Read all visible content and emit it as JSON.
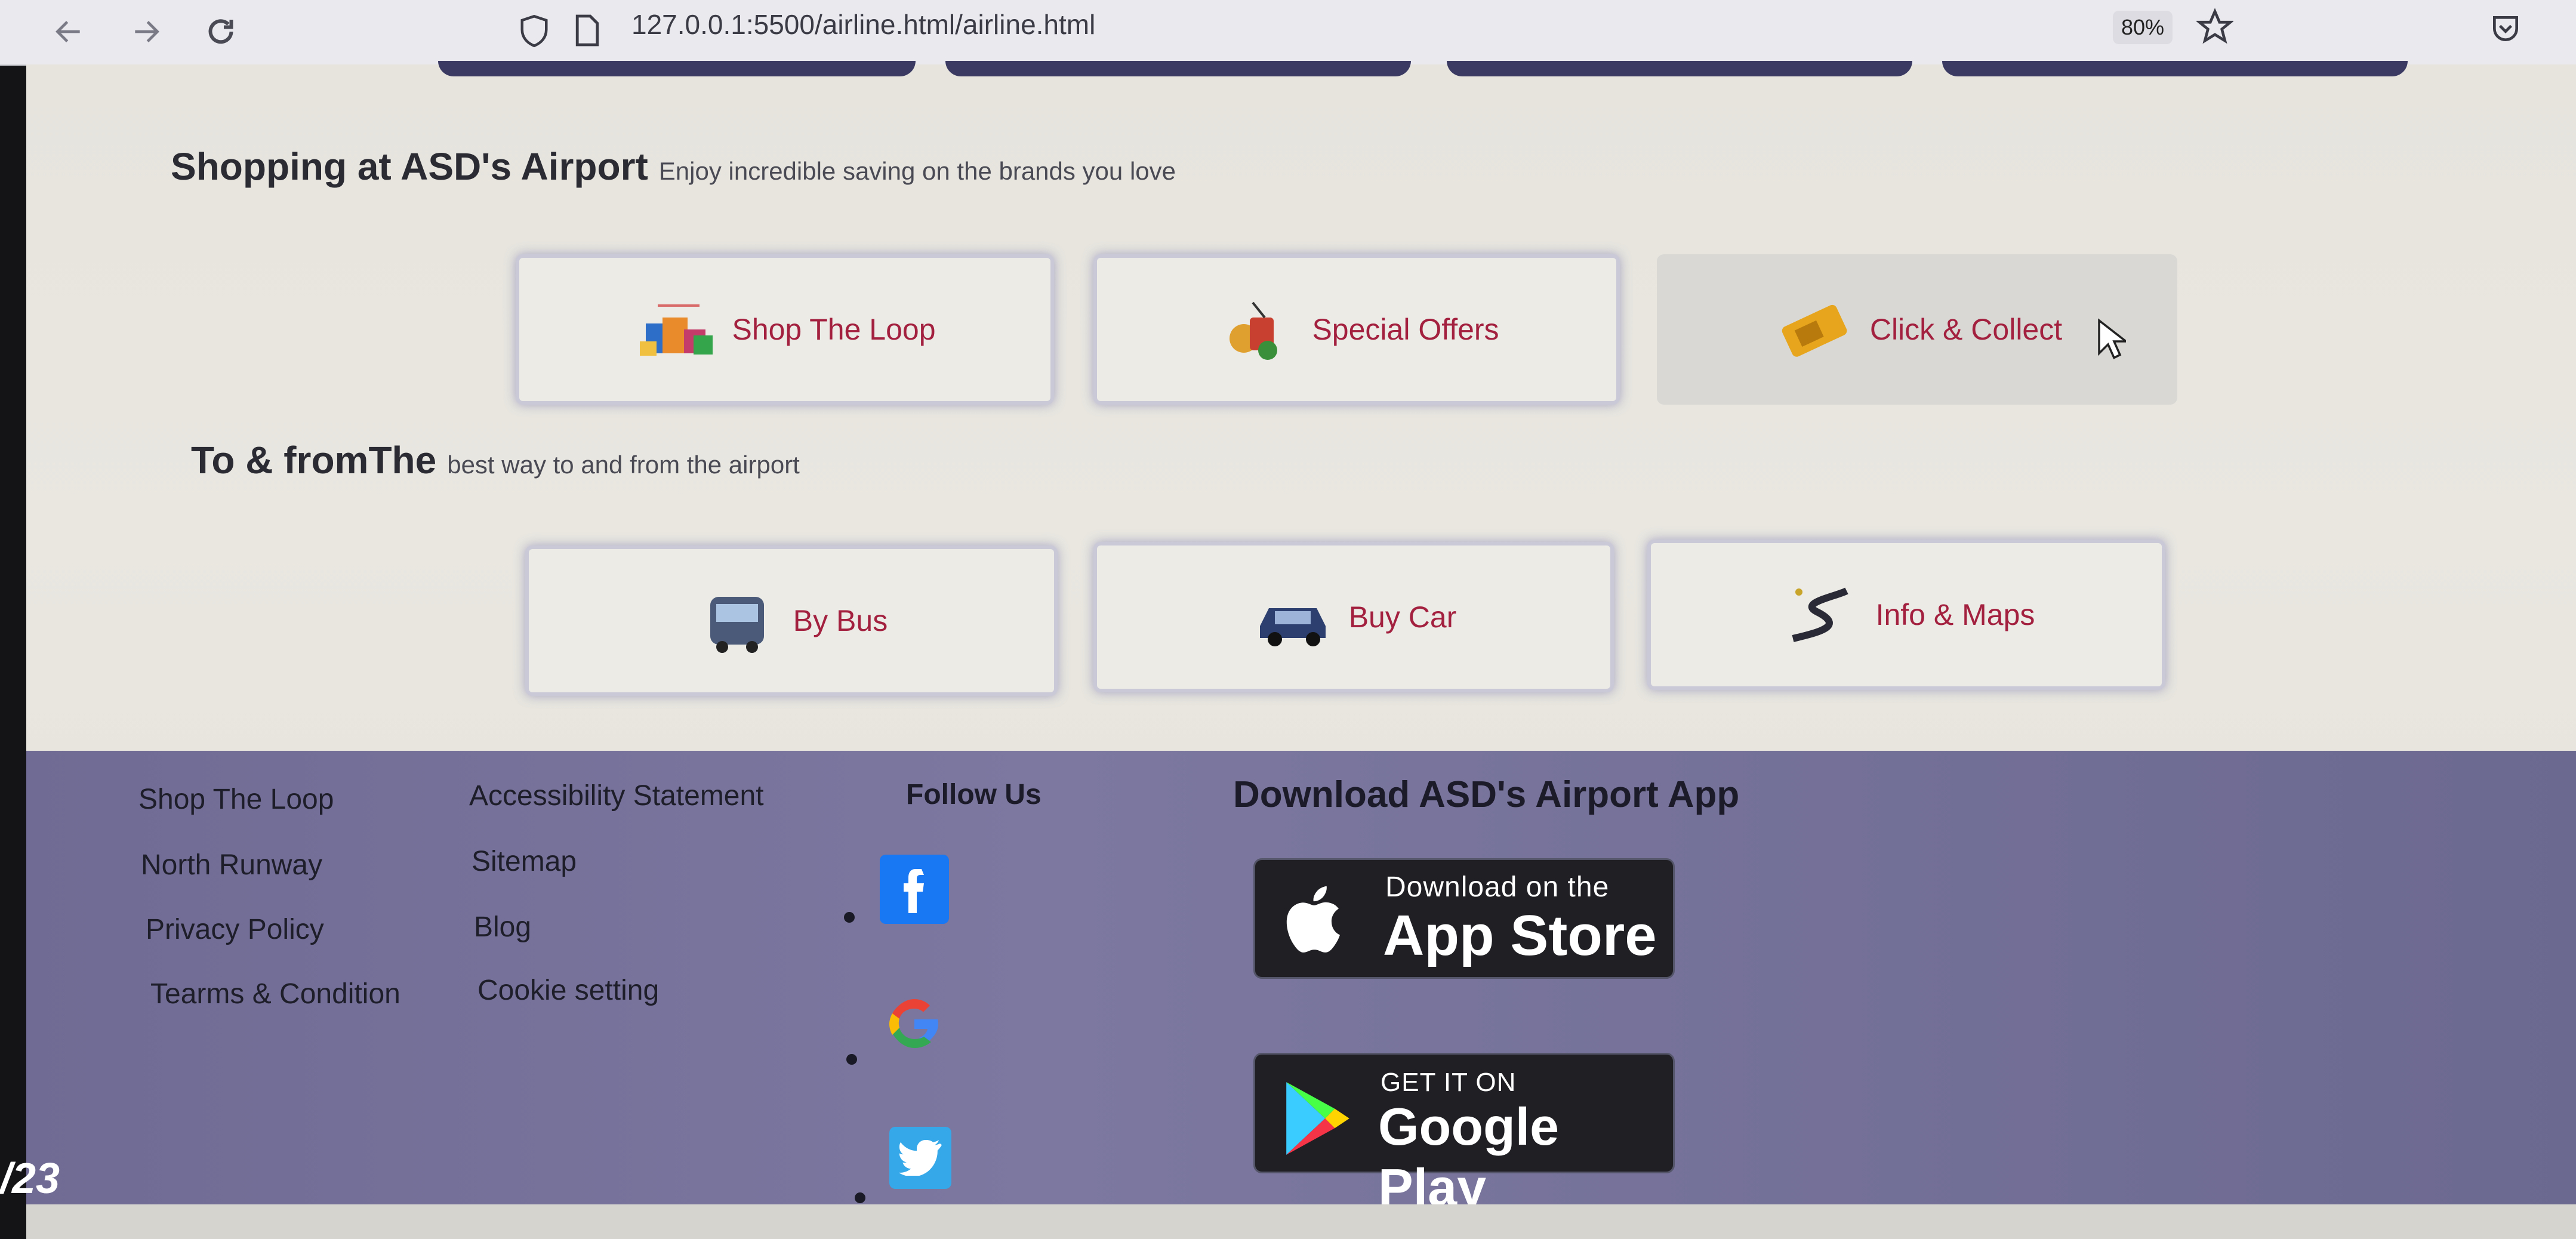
{
  "browser": {
    "url": "127.0.0.1:5500/airline.html/airline.html",
    "zoom": "80%"
  },
  "shopping": {
    "title": "Shopping at ASD's Airport",
    "subtitle": "Enjoy incredible saving on the brands you love",
    "cards": [
      {
        "label": "Shop The Loop",
        "icon": "shopping-bags-icon"
      },
      {
        "label": "Special Offers",
        "icon": "special-offers-icon"
      },
      {
        "label": "Click & Collect",
        "icon": "ticket-icon"
      }
    ]
  },
  "transport": {
    "title": "To & fromThe",
    "subtitle": "best way to and from the airport",
    "cards": [
      {
        "label": "By Bus",
        "icon": "bus-icon"
      },
      {
        "label": "Buy Car",
        "icon": "car-icon"
      },
      {
        "label": "Info & Maps",
        "icon": "map-route-icon"
      }
    ]
  },
  "footer": {
    "col1": [
      "Shop The Loop",
      "North Runway",
      "Privacy Policy",
      "Tearms & Condition"
    ],
    "col2": [
      "Accessibility Statement",
      "Sitemap",
      "Blog",
      "Cookie setting"
    ],
    "follow_title": "Follow Us",
    "social": [
      "facebook-icon",
      "google-icon",
      "twitter-icon"
    ],
    "app_title": "Download ASD's Airport App",
    "app_store": {
      "small": "Download on the",
      "big": "App Store"
    },
    "google_play": {
      "small": "GET IT ON",
      "big": "Google Play"
    }
  },
  "overlay": {
    "watermark": "/23"
  },
  "colors": {
    "accent": "#a3213f",
    "footer_bg": "#75719a",
    "page_bg": "#e6e4dd"
  }
}
